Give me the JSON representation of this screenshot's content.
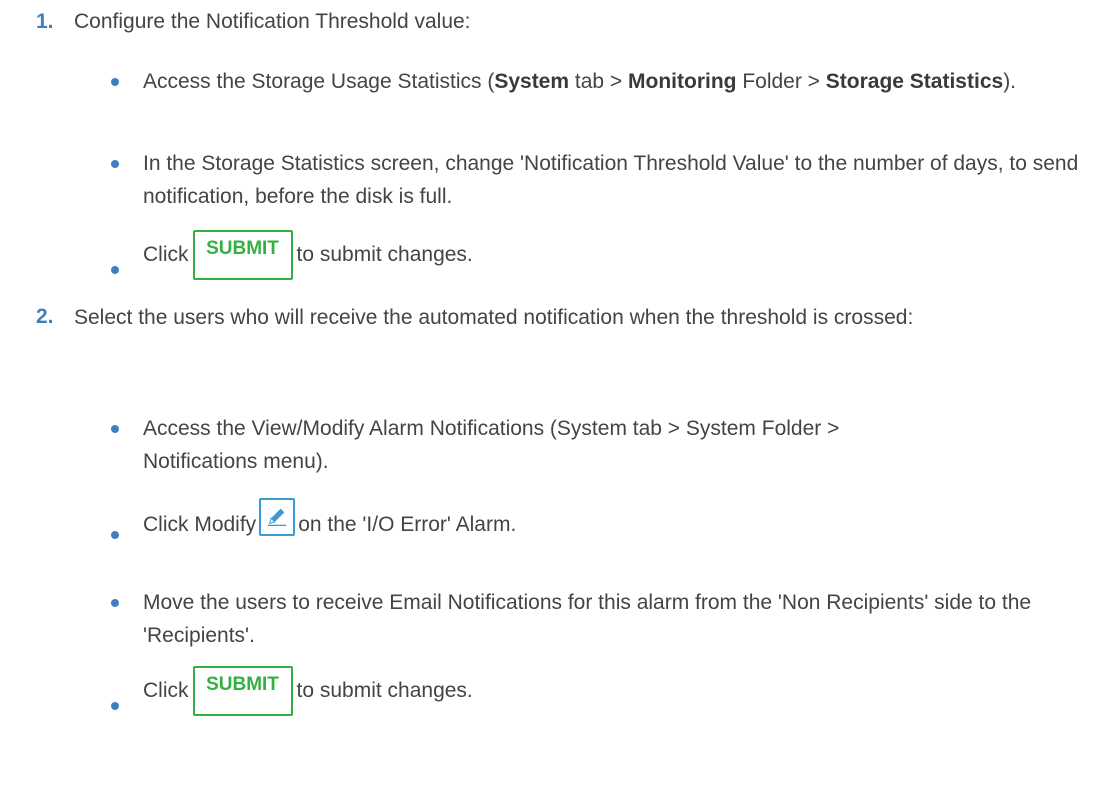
{
  "steps": [
    {
      "number": "1.",
      "text": "Configure the Notification Threshold value:",
      "bullets": [
        {
          "parts": [
            {
              "t": "Access the Storage Usage Statistics ("
            },
            {
              "b": "System"
            },
            {
              "t": " tab > "
            },
            {
              "b": "Monitoring"
            },
            {
              "t": " Folder > "
            },
            {
              "b": "Storage Statistics"
            },
            {
              "t": ")."
            }
          ]
        },
        {
          "parts": [
            {
              "t": "In the Storage Statistics screen, change 'Notification Threshold Value' to the number of days, to send notification, before the disk is full."
            }
          ]
        },
        {
          "click_label": "Click",
          "button_label": "SUBMIT",
          "after": "to submit changes."
        }
      ]
    },
    {
      "number": "2.",
      "text": "Select the users who will receive the automated notification when the threshold is crossed:",
      "bullets": [
        {
          "parts": [
            {
              "t": "Access the View/Modify Alarm Notifications (System tab > System Folder > Notifications menu)."
            }
          ]
        },
        {
          "click_label": "Click Modify",
          "icon": "pencil-edit-icon",
          "after": "on the 'I/O Error' Alarm."
        },
        {
          "parts": [
            {
              "t": "Move the users to receive Email Notifications for this alarm from the 'Non Recipients' side to the 'Recipients'."
            }
          ]
        },
        {
          "click_label": "Click",
          "button_label": "SUBMIT",
          "after": "to submit changes."
        }
      ]
    }
  ],
  "colors": {
    "accent": "#3f7fc0",
    "submit_green": "#34b043",
    "edit_blue": "#3c9ad4"
  }
}
